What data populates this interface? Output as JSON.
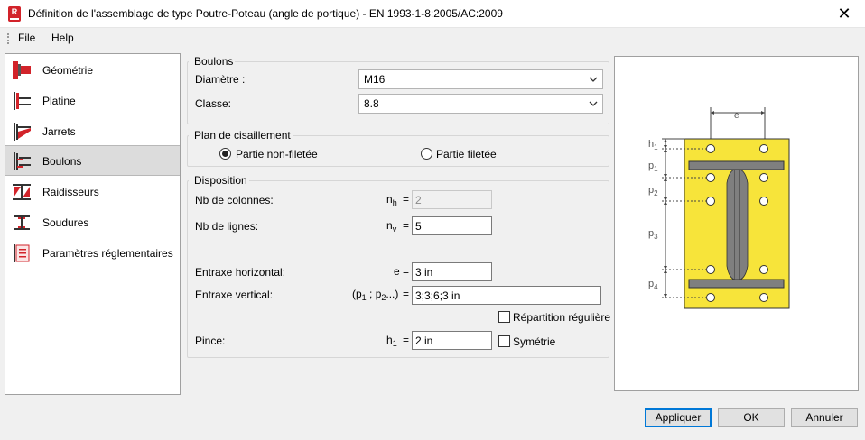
{
  "window": {
    "title": "Définition de l'assemblage de type Poutre-Poteau (angle de portique) - EN 1993-1-8:2005/AC:2009",
    "app_icon_letter": "R",
    "close_glyph": "✕"
  },
  "menu": {
    "file": "File",
    "help": "Help"
  },
  "nav": {
    "items": [
      {
        "label": "Géométrie",
        "icon": "geometry-icon"
      },
      {
        "label": "Platine",
        "icon": "plate-icon"
      },
      {
        "label": "Jarrets",
        "icon": "haunch-icon"
      },
      {
        "label": "Boulons",
        "icon": "bolts-icon",
        "selected": true
      },
      {
        "label": "Raidisseurs",
        "icon": "stiffeners-icon"
      },
      {
        "label": "Soudures",
        "icon": "welds-icon"
      },
      {
        "label": "Paramètres réglementaires",
        "icon": "code-parameters-icon"
      }
    ]
  },
  "boulons": {
    "title": "Boulons",
    "diametre_label": "Diamètre :",
    "diametre_value": "M16",
    "classe_label": "Classe:",
    "classe_value": "8.8"
  },
  "cisaillement": {
    "title": "Plan de cisaillement",
    "option1": "Partie non-filetée",
    "option2": "Partie filetée",
    "selected": "option1"
  },
  "disposition": {
    "title": "Disposition",
    "nb_colonnes_label": "Nb de colonnes:",
    "nb_colonnes_sym": "n",
    "nb_colonnes_sub": "h",
    "nb_colonnes_value": "2",
    "nb_lignes_label": "Nb de lignes:",
    "nb_lignes_sym": "n",
    "nb_lignes_sub": "v",
    "nb_lignes_value": "5",
    "entraxe_h_label": "Entraxe horizontal:",
    "entraxe_h_sym": "e",
    "entraxe_h_value": "3 in",
    "entraxe_v_label": "Entraxe vertical:",
    "entraxe_v_sym_open": "(p",
    "entraxe_v_sub1": "1",
    "entraxe_v_sym_mid": " ; p",
    "entraxe_v_sub2": "2",
    "entraxe_v_sym_close": "...)",
    "entraxe_v_value": "3;3;6;3 in",
    "repartition_label": "Répartition régulière",
    "pince_label": "Pince:",
    "pince_sym": "h",
    "pince_sub": "1",
    "pince_value": "2 in",
    "symetrie_label": "Symétrie",
    "equals": "="
  },
  "diagram": {
    "label_e": "e",
    "label_h": "h",
    "label_h_sub": "1",
    "label_p1": "p",
    "label_p1_sub": "1",
    "label_p2": "p",
    "label_p2_sub": "2",
    "label_p3": "p",
    "label_p3_sub": "3",
    "label_p4": "p",
    "label_p4_sub": "4",
    "plate_color": "#f7e43a",
    "section_color": "#7f7f7f"
  },
  "buttons": {
    "apply": "Appliquer",
    "ok": "OK",
    "cancel": "Annuler"
  }
}
